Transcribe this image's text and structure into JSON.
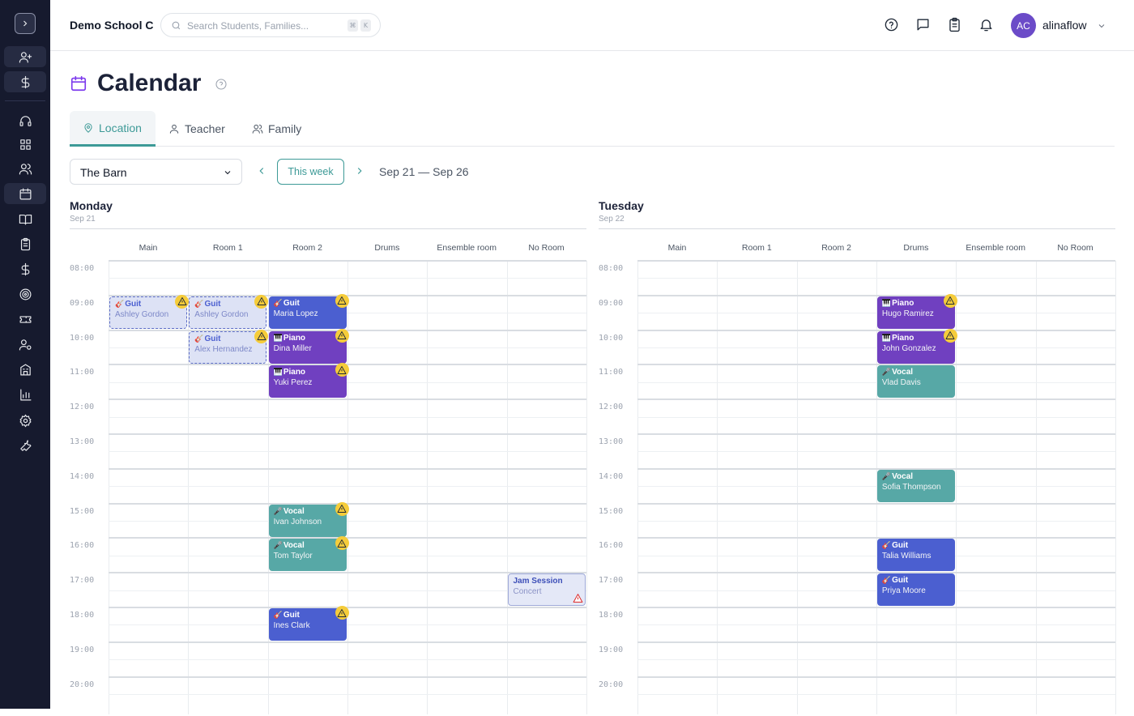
{
  "header": {
    "school_name": "Demo School C",
    "search_placeholder": "Search Students, Families...",
    "shortcut_keys": [
      "⌘",
      "K"
    ],
    "user_initials": "AC",
    "user_name": "alinaflow"
  },
  "sidebar": {
    "items": [
      "toggle",
      "add-student",
      "billing",
      "support",
      "dashboard",
      "students",
      "calendar",
      "lessons",
      "tasks",
      "payments",
      "goals",
      "tickets",
      "teachers",
      "locations",
      "reports",
      "settings",
      "tools"
    ],
    "active": "calendar"
  },
  "page": {
    "title": "Calendar",
    "tabs": [
      {
        "label": "Location",
        "icon": "map-pin-icon",
        "active": true
      },
      {
        "label": "Teacher",
        "icon": "user-icon",
        "active": false
      },
      {
        "label": "Family",
        "icon": "users-icon",
        "active": false
      }
    ],
    "location_select": "The Barn",
    "this_week_label": "This week",
    "date_range": "Sep 21 — Sep 26"
  },
  "colors": {
    "accent": "#3d9a97",
    "guitar": "#4b5fd0",
    "piano": "#7040c0",
    "vocal": "#57a8a6",
    "sidebar": "#161a2e",
    "warning": "#f5cc3a"
  },
  "rooms": [
    "Main",
    "Room 1",
    "Room 2",
    "Drums",
    "Ensemble room",
    "No Room"
  ],
  "times": [
    "08:00",
    "09:00",
    "10:00",
    "11:00",
    "12:00",
    "13:00",
    "14:00",
    "15:00",
    "16:00",
    "17:00",
    "18:00",
    "19:00",
    "20:00"
  ],
  "days": [
    {
      "name": "Monday",
      "date": "Sep 21",
      "events": [
        {
          "room": 0,
          "start": 9,
          "type": "ghost",
          "emoji": "🎸",
          "title": "Guit",
          "name": "Ashley Gordon",
          "warning": true
        },
        {
          "room": 1,
          "start": 9,
          "type": "ghost",
          "emoji": "🎸",
          "title": "Guit",
          "name": "Ashley Gordon",
          "warning": true
        },
        {
          "room": 2,
          "start": 9,
          "type": "guitar",
          "emoji": "🎸",
          "title": "Guit",
          "name": "Maria Lopez",
          "warning": true
        },
        {
          "room": 1,
          "start": 10,
          "type": "ghost",
          "emoji": "🎸",
          "title": "Guit",
          "name": "Alex Hernandez",
          "warning": true
        },
        {
          "room": 2,
          "start": 10,
          "type": "piano",
          "emoji": "🎹",
          "title": "Piano",
          "name": "Dina Miller",
          "warning": true
        },
        {
          "room": 2,
          "start": 11,
          "type": "piano",
          "emoji": "🎹",
          "title": "Piano",
          "name": "Yuki Perez",
          "warning": true
        },
        {
          "room": 2,
          "start": 15,
          "type": "vocal",
          "emoji": "🎤",
          "title": "Vocal",
          "name": "Ivan Johnson",
          "warning": true
        },
        {
          "room": 2,
          "start": 16,
          "type": "vocal",
          "emoji": "🎤",
          "title": "Vocal",
          "name": "Tom Taylor",
          "warning": true
        },
        {
          "room": 5,
          "start": 17,
          "type": "concert",
          "emoji": "",
          "title": "Jam Session",
          "name": "Concert",
          "warning": false,
          "error": true
        },
        {
          "room": 2,
          "start": 18,
          "type": "guitar",
          "emoji": "🎸",
          "title": "Guit",
          "name": "Ines Clark",
          "warning": true
        }
      ]
    },
    {
      "name": "Tuesday",
      "date": "Sep 22",
      "events": [
        {
          "room": 3,
          "start": 9,
          "type": "piano",
          "emoji": "🎹",
          "title": "Piano",
          "name": "Hugo Ramirez",
          "warning": true
        },
        {
          "room": 3,
          "start": 10,
          "type": "piano",
          "emoji": "🎹",
          "title": "Piano",
          "name": "John Gonzalez",
          "warning": true
        },
        {
          "room": 3,
          "start": 11,
          "type": "vocal",
          "emoji": "🎤",
          "title": "Vocal",
          "name": "Vlad Davis",
          "warning": false
        },
        {
          "room": 3,
          "start": 14,
          "type": "vocal",
          "emoji": "🎤",
          "title": "Vocal",
          "name": "Sofia Thompson",
          "warning": false
        },
        {
          "room": 3,
          "start": 16,
          "type": "guitar",
          "emoji": "🎸",
          "title": "Guit",
          "name": "Talia Williams",
          "warning": false
        },
        {
          "room": 3,
          "start": 17,
          "type": "guitar",
          "emoji": "🎸",
          "title": "Guit",
          "name": "Priya Moore",
          "warning": false
        }
      ]
    }
  ]
}
